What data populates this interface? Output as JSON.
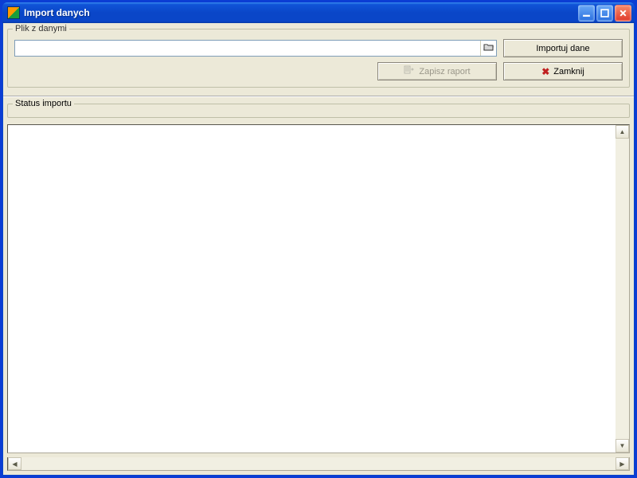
{
  "window": {
    "title": "Import danych"
  },
  "file_group": {
    "legend": "Plik z danymi",
    "path_value": "",
    "path_placeholder": ""
  },
  "buttons": {
    "import": "Importuj dane",
    "save_report": "Zapisz raport",
    "close": "Zamknij"
  },
  "status_group": {
    "legend": "Status importu"
  },
  "status_text": ""
}
